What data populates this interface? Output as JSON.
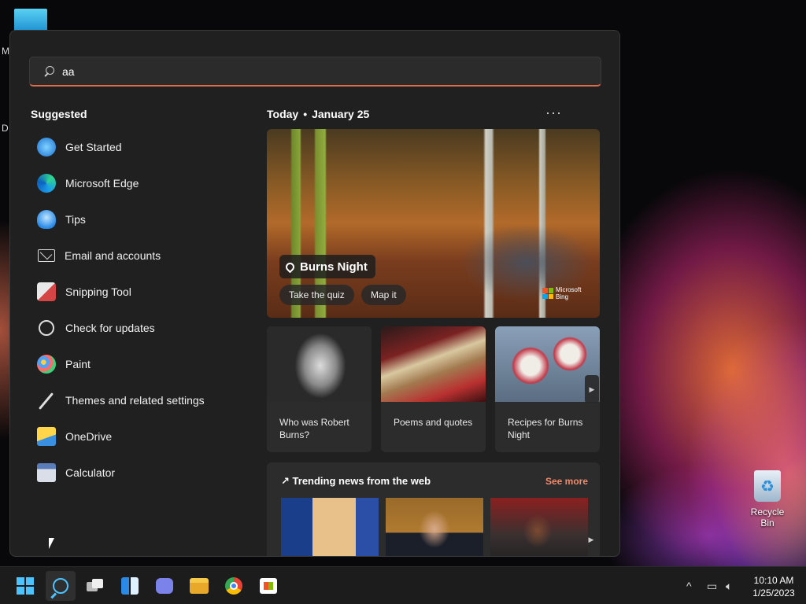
{
  "desktop": {
    "left_letters": [
      "M",
      "D"
    ],
    "recycle_bin_label": "Recycle Bin"
  },
  "search": {
    "value": "aa",
    "placeholder": ""
  },
  "suggested": {
    "title": "Suggested",
    "items": [
      {
        "label": "Get Started",
        "icon": "get-started-icon"
      },
      {
        "label": "Microsoft Edge",
        "icon": "edge-icon"
      },
      {
        "label": "Tips",
        "icon": "tips-icon"
      },
      {
        "label": "Email and accounts",
        "icon": "mail-icon"
      },
      {
        "label": "Snipping Tool",
        "icon": "snipping-tool-icon"
      },
      {
        "label": "Check for updates",
        "icon": "refresh-icon"
      },
      {
        "label": "Paint",
        "icon": "paint-icon"
      },
      {
        "label": "Themes and related settings",
        "icon": "brush-icon"
      },
      {
        "label": "OneDrive",
        "icon": "onedrive-icon"
      },
      {
        "label": "Calculator",
        "icon": "calculator-icon"
      }
    ]
  },
  "today": {
    "label": "Today",
    "separator": "•",
    "date": "January 25",
    "more": "···"
  },
  "hero": {
    "tag": "Burns Night",
    "buttons": [
      "Take the quiz",
      "Map it"
    ],
    "brand": "Microsoft Bing"
  },
  "cards": [
    {
      "caption": "Who was Robert Burns?"
    },
    {
      "caption": "Poems and quotes"
    },
    {
      "caption": "Recipes for Burns Night"
    }
  ],
  "trending": {
    "title": "Trending news from the web",
    "see_more": "See more"
  },
  "taskbar": {
    "tray_chevron": "^",
    "time": "10:10 AM",
    "date": "1/25/2023"
  },
  "colors": {
    "accent": "#e06b4a",
    "taskbar_accent": "#4cc2ff",
    "panel_bg": "#202020"
  }
}
